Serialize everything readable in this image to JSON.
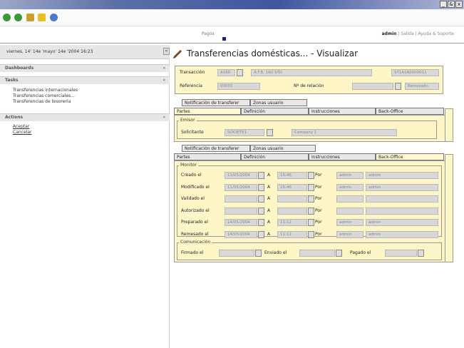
{
  "window": {
    "controls": [
      "_",
      "&",
      "x"
    ]
  },
  "header": {
    "center_label": "Pagos",
    "user": "admin",
    "links": [
      "Salida",
      "Ayuda & Soporte"
    ],
    "sep": "|"
  },
  "left": {
    "date": "viernes, 14' 14e 'mayo' 14e '2004  16:23",
    "dashboards": "Dashboards",
    "tasks": "Tasks",
    "actions": "Actions",
    "task_items": [
      "Transferencias internacionales",
      "Transferencias comerciales...",
      "Transferencias de tesorería"
    ],
    "action_items": [
      "Aceptar",
      "Cancelar"
    ],
    "toggle": "«",
    "pm_closed": "»",
    "pm_open": "«"
  },
  "page": {
    "title": "Transferencias domésticas... - Visualizar"
  },
  "top": {
    "transaccion_label": "Transacción",
    "transaccion_code": "A160",
    "transaccion_desc": "A.F.B. 160 STD",
    "transaccion_id": "ST1A160000011",
    "referencia_label": "Referencia",
    "referencia_val": "00001",
    "relacion_label": "Nº de relación",
    "relacion_status": "Remesado"
  },
  "tabs1": {
    "sub": [
      "Notificación de transferer",
      "Zonas usuario"
    ],
    "main": [
      "Partes",
      "Definición",
      "Instrucciones",
      "Back-Office"
    ],
    "tabs_arrow": ">"
  },
  "emisor": {
    "title": "Emisor",
    "label": "Solicitante",
    "code": "SOCIETE1",
    "name": "Company 1"
  },
  "tabs2": {
    "sub": [
      "Notificación de transferer",
      "Zonas usuario"
    ],
    "main": [
      "Partes",
      "Definición",
      "Instrucciones",
      "Back-Office"
    ]
  },
  "monitor": {
    "title": "Monitor",
    "a": "A",
    "por": "Por",
    "rows": [
      {
        "label": "Creado el",
        "date": "11/05/2004",
        "time": "15:46",
        "user1": "admin",
        "user2": "admin"
      },
      {
        "label": "Modificado el",
        "date": "11/05/2004",
        "time": "15:46",
        "user1": "admin",
        "user2": "admin"
      },
      {
        "label": "Validado el",
        "date": "",
        "time": "",
        "user1": "",
        "user2": ""
      },
      {
        "label": "Autorizado el",
        "date": "",
        "time": "",
        "user1": "",
        "user2": ""
      },
      {
        "label": "Preparado el",
        "date": "14/05/2004",
        "time": "11:12",
        "user1": "admin",
        "user2": "admin"
      },
      {
        "label": "Remesado el",
        "date": "14/05/2004",
        "time": "11:12",
        "user1": "admin",
        "user2": "admin"
      }
    ]
  },
  "comunicacion": {
    "title": "Comunicación",
    "firmado": "Firmado el",
    "enviado": "Enviado el",
    "pagado": "Pagado el"
  }
}
